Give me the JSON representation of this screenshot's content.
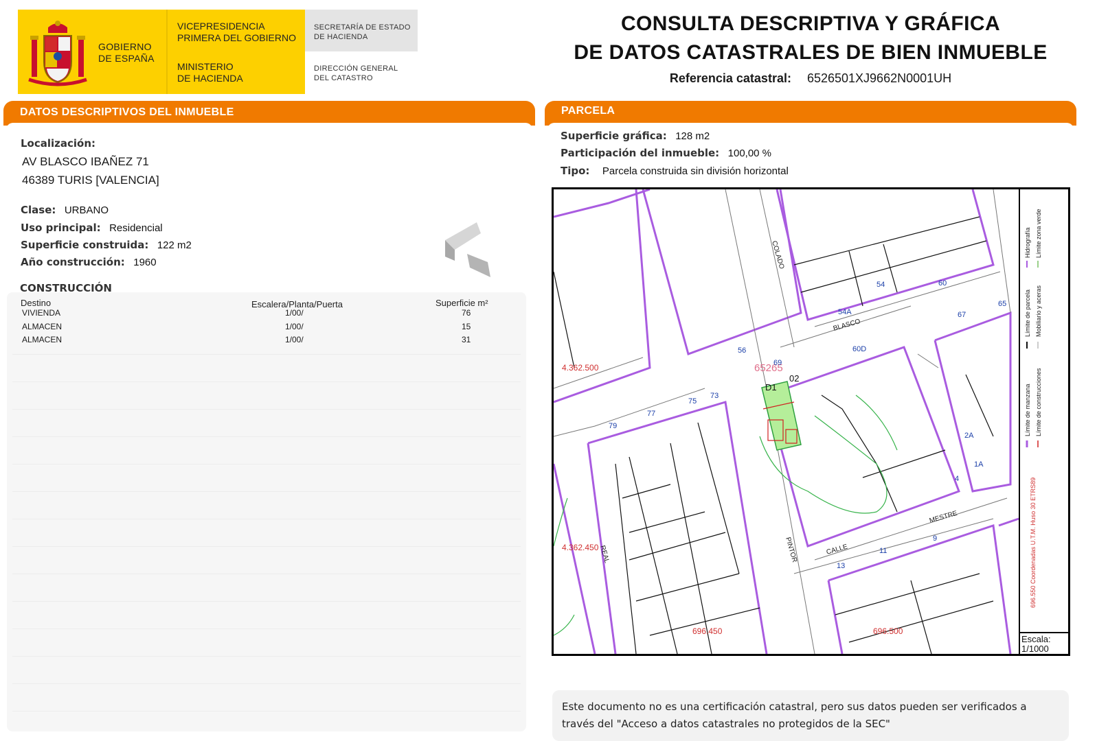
{
  "header": {
    "gob_line1": "GOBIERNO",
    "gob_line2": "DE ESPAÑA",
    "vice_line1": "VICEPRESIDENCIA",
    "vice_line2": "PRIMERA DEL GOBIERNO",
    "min_line1": "MINISTERIO",
    "min_line2": "DE HACIENDA",
    "sec_line1": "SECRETARÍA DE ESTADO",
    "sec_line2": "DE HACIENDA",
    "dg_line1": "DIRECCIÓN GENERAL",
    "dg_line2": "DEL CATASTRO",
    "title_line1": "CONSULTA DESCRIPTIVA Y GRÁFICA",
    "title_line2": "DE DATOS CATASTRALES DE BIEN INMUEBLE",
    "ref_label": "Referencia catastral:",
    "ref_value": "6526501XJ9662N0001UH"
  },
  "left": {
    "bar_title": "DATOS DESCRIPTIVOS DEL INMUEBLE",
    "loc_label": "Localización:",
    "loc_line1": "AV BLASCO IBAÑEZ 71",
    "loc_line2": "46389 TURIS [VALENCIA]",
    "clase_label": "Clase:",
    "clase_value": "URBANO",
    "uso_label": "Uso principal:",
    "uso_value": "Residencial",
    "sup_label": "Superficie construida:",
    "sup_value": "122 m2",
    "anio_label": "Año construcción:",
    "anio_value": "1960",
    "cons_title": "CONSTRUCCIÓN",
    "cons_headers": [
      "Destino",
      "Escalera/Planta/Puerta",
      "Superficie m²"
    ],
    "cons_rows": [
      {
        "destino": "VIVIENDA",
        "epp": "1/00/",
        "sup": "76"
      },
      {
        "destino": "ALMACEN",
        "epp": "1/00/",
        "sup": "15"
      },
      {
        "destino": "ALMACEN",
        "epp": "1/00/",
        "sup": "31"
      }
    ]
  },
  "right": {
    "bar_title": "PARCELA",
    "supg_label": "Superficie gráfica:",
    "supg_value": "128 m2",
    "part_label": "Participación del inmueble:",
    "part_value": "100,00 %",
    "tipo_label": "Tipo:",
    "tipo_value": "Parcela construida sin división horizontal",
    "map": {
      "coord_y1": "4.362.500",
      "coord_y2": "4.362.450",
      "coord_x1": "696.450",
      "coord_x2": "696.500",
      "parcel_ref": "65265",
      "label_d1": "D1",
      "label_d2": "02",
      "street_blasco": "BLASCO",
      "street_mestre": "MESTRE",
      "street_calle": "CALLE",
      "street_pintor": "PINTOR",
      "street_real": "REAL",
      "street_colado": "COLADO",
      "nums": [
        "54",
        "54A",
        "56",
        "60",
        "60D",
        "65",
        "67",
        "69",
        "73",
        "75",
        "77",
        "79",
        "11",
        "13",
        "9",
        "2A",
        "1A",
        "4"
      ]
    },
    "legend": {
      "items": [
        "Hidrografía",
        "Límite zona verde",
        "Límite de parcela",
        "Mobiliario y aceras",
        "Límite de manzana",
        "Límite de construcciones"
      ],
      "coords": "696.550 Coordenadas U.T.M. Huso 30 ETRS89",
      "scale_label": "Escala:",
      "scale_value": "1/1000"
    }
  },
  "note": {
    "text": "Este documento no es una certificación catastral, pero sus datos pueden ser verificados a través del \"Acceso a datos catastrales no protegidos de la SEC\""
  },
  "colors": {
    "orange": "#f07a00",
    "yellow": "#fdd000",
    "purple": "#a95ce0",
    "parcel_green": "#b5ee9a"
  }
}
